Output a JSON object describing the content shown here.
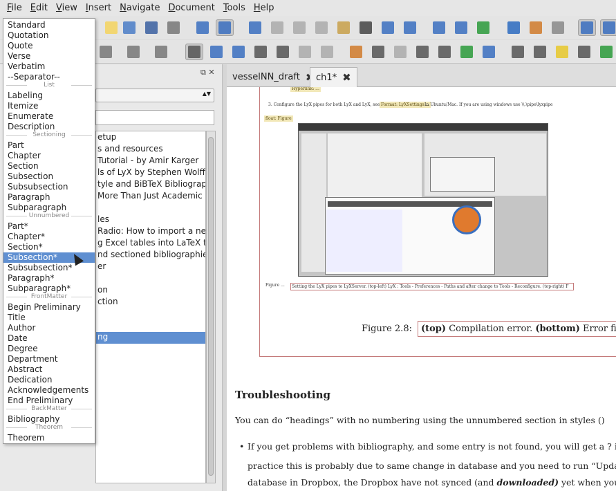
{
  "menubar": [
    "File",
    "Edit",
    "View",
    "Insert",
    "Navigate",
    "Document",
    "Tools",
    "Help"
  ],
  "tabs": [
    {
      "label": "vesselNN_draft",
      "active": false
    },
    {
      "label": "ch1*",
      "active": true
    }
  ],
  "outline": [
    {
      "label": "etup",
      "sel": false
    },
    {
      "label": "s and resources",
      "sel": false
    },
    {
      "label": "Tutorial - by Amir Karger",
      "sel": false
    },
    {
      "label": "ls of LyX by Stephen Wolff",
      "sel": false
    },
    {
      "label": "tyle and BiBTeX Bibliograph",
      "sel": false
    },
    {
      "label": "More Than Just Academic Pap",
      "sel": false
    },
    {
      "label": "",
      "sel": false
    },
    {
      "label": "les",
      "sel": false
    },
    {
      "label": "Radio: How to import a new ...",
      "sel": false
    },
    {
      "label": "g Excel tables into LaTeX ta...",
      "sel": false
    },
    {
      "label": "nd sectioned bibliographies",
      "sel": false
    },
    {
      "label": "er",
      "sel": false
    },
    {
      "label": "",
      "sel": false
    },
    {
      "label": "on",
      "sel": false
    },
    {
      "label": "ction",
      "sel": false
    },
    {
      "label": "",
      "sel": false
    },
    {
      "label": "",
      "sel": false
    },
    {
      "label": "ng",
      "sel": true
    }
  ],
  "layout_menu": [
    {
      "t": "item",
      "label": "Standard"
    },
    {
      "t": "item",
      "label": "Quotation"
    },
    {
      "t": "item",
      "label": "Quote"
    },
    {
      "t": "item",
      "label": "Verse"
    },
    {
      "t": "item",
      "label": "Verbatim"
    },
    {
      "t": "item",
      "label": "--Separator--"
    },
    {
      "t": "sep",
      "label": "List"
    },
    {
      "t": "item",
      "label": "Labeling"
    },
    {
      "t": "item",
      "label": "Itemize"
    },
    {
      "t": "item",
      "label": "Enumerate"
    },
    {
      "t": "item",
      "label": "Description"
    },
    {
      "t": "sep",
      "label": "Sectioning"
    },
    {
      "t": "item",
      "label": "Part"
    },
    {
      "t": "item",
      "label": "Chapter"
    },
    {
      "t": "item",
      "label": "Section"
    },
    {
      "t": "item",
      "label": "Subsection"
    },
    {
      "t": "item",
      "label": "Subsubsection"
    },
    {
      "t": "item",
      "label": "Paragraph"
    },
    {
      "t": "item",
      "label": "Subparagraph"
    },
    {
      "t": "sep",
      "label": "Unnumbered"
    },
    {
      "t": "item",
      "label": "Part*"
    },
    {
      "t": "item",
      "label": "Chapter*"
    },
    {
      "t": "item",
      "label": "Section*"
    },
    {
      "t": "item",
      "label": "Subsection*",
      "sel": true
    },
    {
      "t": "item",
      "label": "Subsubsection*"
    },
    {
      "t": "item",
      "label": "Paragraph*"
    },
    {
      "t": "item",
      "label": "Subparagraph*"
    },
    {
      "t": "sep",
      "label": "FrontMatter"
    },
    {
      "t": "item",
      "label": "Begin Preliminary"
    },
    {
      "t": "item",
      "label": "Title"
    },
    {
      "t": "item",
      "label": "Author"
    },
    {
      "t": "item",
      "label": "Date"
    },
    {
      "t": "item",
      "label": "Degree"
    },
    {
      "t": "item",
      "label": "Department"
    },
    {
      "t": "item",
      "label": "Abstract"
    },
    {
      "t": "item",
      "label": "Dedication"
    },
    {
      "t": "item",
      "label": "Acknowledgements"
    },
    {
      "t": "item",
      "label": "End Preliminary"
    },
    {
      "t": "sep",
      "label": "BackMatter"
    },
    {
      "t": "item",
      "label": "Bibliography"
    },
    {
      "t": "sep",
      "label": "Theorem"
    },
    {
      "t": "item",
      "label": "Theorem"
    }
  ],
  "doc": {
    "step3": "3. Configure the LyX pipes for both LyX and LyX, see",
    "step3_tag": "Format: LyXSettings ...",
    "step3_tail": "In Ubuntu/Mac. If you are using windows use \\\\.\\pipe\\lyxpipe",
    "float_label": "float: Figure",
    "figure_label": "Figure 2.8:",
    "caption_top": "(top)",
    "caption_mid": "Compilation error.",
    "caption_bottom": "(bottom)",
    "caption_end": "Error fixed a",
    "heading": "Troubleshooting",
    "para": "You can do “headings” with no numbering using the unnumbered section in styles ()",
    "bullet1": "If you get problems with bibliography, and some entry is not found, you will get a ? in",
    "bullet2": "practice this is probably due to same change in database and you need to run “Update I",
    "bullet3_a": "database in Dropbox, the Dropbox have not synced (and ",
    "bullet3_b": "downloaded)",
    "bullet3_c": " yet when you for"
  }
}
